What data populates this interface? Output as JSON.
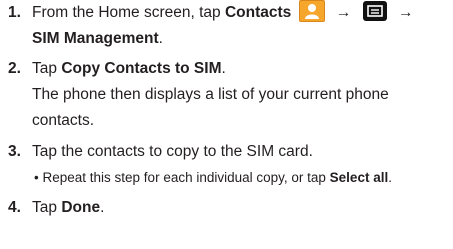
{
  "steps": [
    {
      "number": "1.",
      "text_before_icons": "From the Home screen, tap ",
      "contacts_label": "Contacts",
      "arrow_1": "→",
      "arrow_2": "→",
      "line2_bold": "SIM Management",
      "line2_end": ".",
      "icons": [
        "contacts-app-icon",
        "menu-key-icon"
      ]
    },
    {
      "number": "2.",
      "text_before": "Tap ",
      "bold": "Copy Contacts to SIM",
      "text_after": ".",
      "detail_line1": "The phone then displays a list of your current phone",
      "detail_line2": "contacts."
    },
    {
      "number": "3.",
      "text": "Tap the contacts to copy to the SIM card.",
      "bullet": "•",
      "bullet_text_before": "Repeat this step for each individual copy, or tap ",
      "bullet_bold": "Select all",
      "bullet_text_after": "."
    },
    {
      "number": "4.",
      "text_before": "Tap ",
      "bold": "Done",
      "text_after": "."
    }
  ],
  "colors": {
    "text": "#231f20",
    "contacts_icon": "#f6a62a",
    "menu_icon": "#111111"
  }
}
